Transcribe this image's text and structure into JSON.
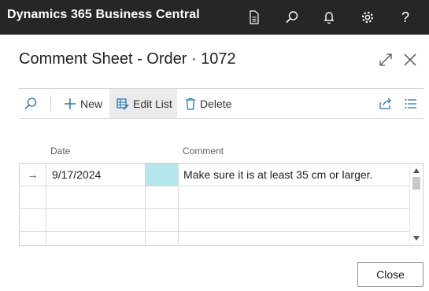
{
  "app": {
    "title": "Dynamics 365 Business Central"
  },
  "topbar_icons": [
    "document-icon",
    "search-icon",
    "bell-icon",
    "gear-icon",
    "help-icon"
  ],
  "topbar_help_glyph": "?",
  "dialog": {
    "title": "Comment Sheet - Order · 1072"
  },
  "toolbar": {
    "new_label": "New",
    "edit_list_label": "Edit List",
    "delete_label": "Delete"
  },
  "columns": {
    "date": "Date",
    "comment": "Comment"
  },
  "rows": [
    {
      "indicator": "→",
      "date": "9/17/2024",
      "comment": "Make sure it is at least 35 cm or larger."
    },
    {
      "indicator": "",
      "date": "",
      "comment": ""
    },
    {
      "indicator": "",
      "date": "",
      "comment": ""
    },
    {
      "indicator": "",
      "date": "",
      "comment": ""
    }
  ],
  "footer": {
    "close_label": "Close"
  },
  "colors": {
    "topbar": "#262626",
    "selected_cell": "#b4e6eb",
    "edit_list_active": "#ebebeb",
    "accent": "#1a6fb5"
  }
}
